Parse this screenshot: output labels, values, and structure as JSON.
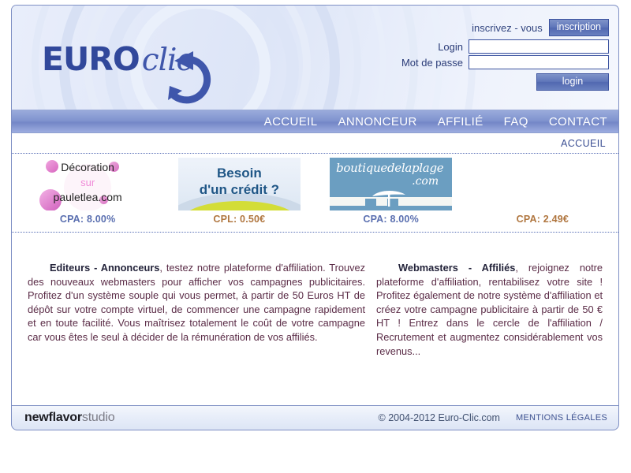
{
  "site": {
    "logo_primary": "EURO",
    "logo_secondary": "clic"
  },
  "login": {
    "signup_prompt": "inscrivez - vous",
    "signup_button": "inscription",
    "login_label": "Login",
    "login_value": "",
    "login_placeholder": "",
    "password_label": "Mot de passe",
    "password_value": "",
    "password_placeholder": "",
    "submit_button": "login"
  },
  "nav": {
    "items": [
      {
        "label": "ACCUEIL"
      },
      {
        "label": "ANNONCEUR"
      },
      {
        "label": "AFFILIÉ"
      },
      {
        "label": "FAQ"
      },
      {
        "label": "CONTACT"
      }
    ]
  },
  "breadcrumb": {
    "current": "ACCUEIL"
  },
  "banners": [
    {
      "name": "pauletlea",
      "line1": "Décoration",
      "line2": "sur",
      "line3": "pauletlea.com",
      "price": "CPA: 8.00%",
      "price_color": "blue"
    },
    {
      "name": "besoin-credit",
      "line1": "Besoin",
      "line2": "d'un crédit ?",
      "price": "CPL: 0.50€",
      "price_color": "orange"
    },
    {
      "name": "boutiquedelaplage",
      "line1": "boutiquedelaplage",
      "line2": ".com",
      "price": "CPA: 8.00%",
      "price_color": "blue"
    },
    {
      "name": "empty-slot",
      "line1": "",
      "line2": "",
      "price": "CPA: 2.49€",
      "price_color": "orange"
    }
  ],
  "content": {
    "left": {
      "heading": "Editeurs - Annonceurs",
      "body": ", testez notre plateforme d'affiliation. Trouvez des nouveaux webmasters pour afficher vos campagnes publicitaires. Profitez d'un système souple qui vous permet, à partir de 50 Euros HT de dépôt sur votre compte virtuel, de commencer une campagne rapidement et en toute facilité. Vous maîtrisez totalement le coût de votre campagne car vous êtes le seul à décider de la rémunération de vos affiliés."
    },
    "right": {
      "heading": "Webmasters - Affiliés",
      "body": ", rejoignez notre plateforme d'affiliation, rentabilisez votre site ! Profitez également de notre système d'affiliation et créez votre campagne publicitaire à partir de 50 € HT ! Entrez dans le cercle de l'affiliation / Recrutement et augmentez considérablement vos revenus..."
    }
  },
  "footer": {
    "studio_bold": "newflavor",
    "studio_light": "studio",
    "copyright": "© 2004-2012 Euro-Clic.com",
    "legal": "MENTIONS LÉGALES"
  },
  "colors": {
    "accent_blue": "#4a5fa8",
    "nav_blue": "#8194cf",
    "text_maroon": "#5a2b46",
    "price_blue": "#5a6fb0",
    "price_orange": "#b0763f"
  }
}
